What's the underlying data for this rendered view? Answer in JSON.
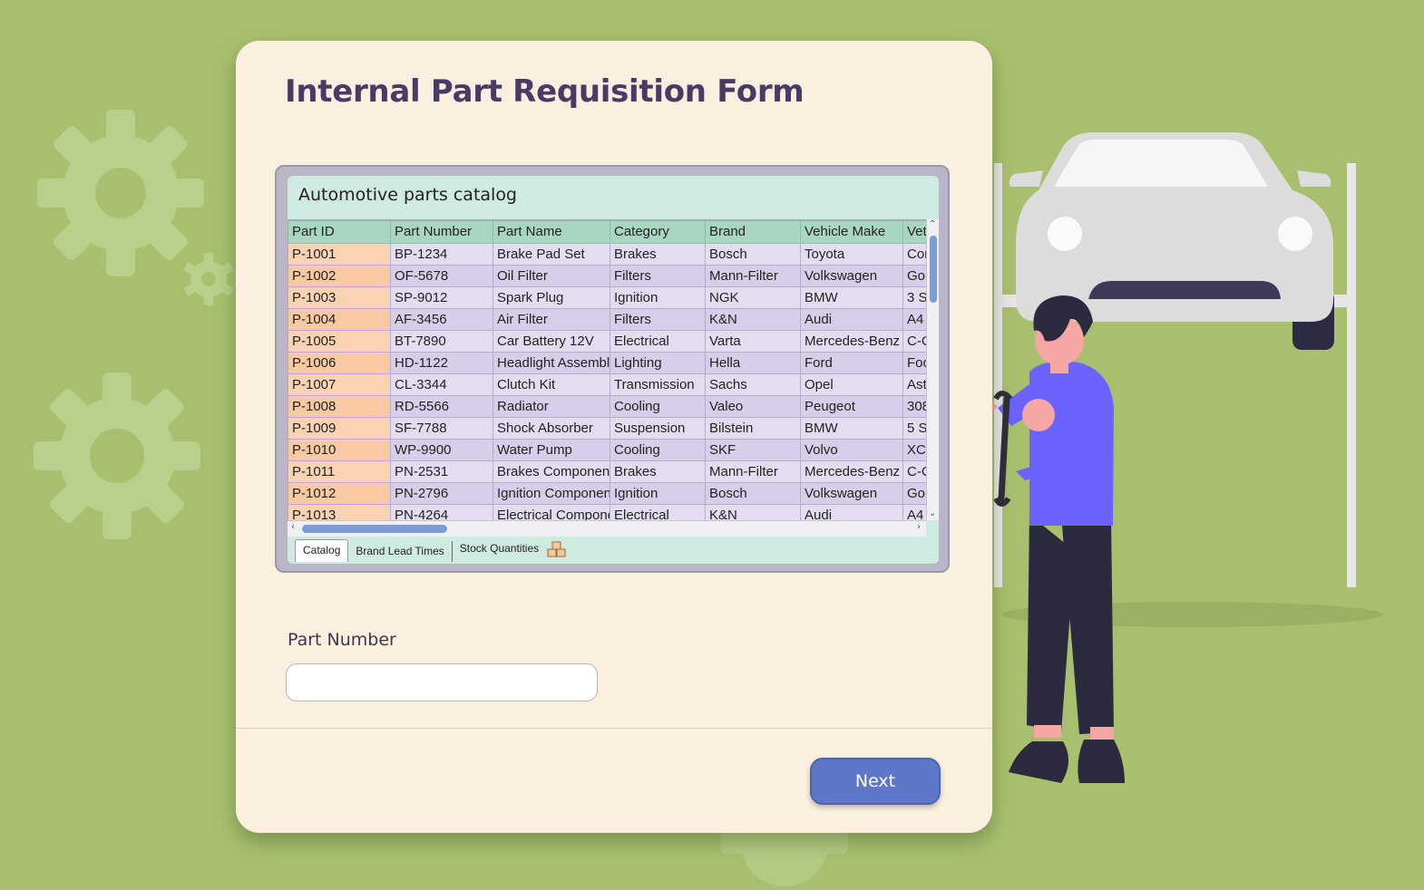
{
  "form": {
    "title": "Internal Part Requisition Form",
    "catalog": {
      "title": "Automotive parts catalog",
      "columns": [
        "Part ID",
        "Part Number",
        "Part Name",
        "Category",
        "Brand",
        "Vehicle Make",
        "Vet"
      ],
      "rows": [
        [
          "P-1001",
          "BP-1234",
          "Brake Pad Set",
          "Brakes",
          "Bosch",
          "Toyota",
          "Cor"
        ],
        [
          "P-1002",
          "OF-5678",
          "Oil Filter",
          "Filters",
          "Mann-Filter",
          "Volkswagen",
          "Gol"
        ],
        [
          "P-1003",
          "SP-9012",
          "Spark Plug",
          "Ignition",
          "NGK",
          "BMW",
          "3 S"
        ],
        [
          "P-1004",
          "AF-3456",
          "Air Filter",
          "Filters",
          "K&N",
          "Audi",
          "A4"
        ],
        [
          "P-1005",
          "BT-7890",
          "Car Battery 12V",
          "Electrical",
          "Varta",
          "Mercedes-Benz",
          "C-C"
        ],
        [
          "P-1006",
          "HD-1122",
          "Headlight Assembl",
          "Lighting",
          "Hella",
          "Ford",
          "Foc"
        ],
        [
          "P-1007",
          "CL-3344",
          "Clutch Kit",
          "Transmission",
          "Sachs",
          "Opel",
          "Ast"
        ],
        [
          "P-1008",
          "RD-5566",
          "Radiator",
          "Cooling",
          "Valeo",
          "Peugeot",
          "308"
        ],
        [
          "P-1009",
          "SF-7788",
          "Shock Absorber",
          "Suspension",
          "Bilstein",
          "BMW",
          "5 S"
        ],
        [
          "P-1010",
          "WP-9900",
          "Water Pump",
          "Cooling",
          "SKF",
          "Volvo",
          "XC9"
        ],
        [
          "P-1011",
          "PN-2531",
          "Brakes Component",
          "Brakes",
          "Mann-Filter",
          "Mercedes-Benz",
          "C-C"
        ],
        [
          "P-1012",
          "PN-2796",
          "Ignition Componen",
          "Ignition",
          "Bosch",
          "Volkswagen",
          "Gol"
        ],
        [
          "P-1013",
          "PN-4264",
          "Electrical Compone",
          "Electrical",
          "K&N",
          "Audi",
          "A4"
        ]
      ],
      "tabs": [
        {
          "label": "Catalog",
          "active": true
        },
        {
          "label": "Brand Lead Times",
          "active": false
        },
        {
          "label": "Stock Quantities",
          "active": false,
          "icon": "boxes-icon"
        }
      ]
    },
    "part_number": {
      "label": "Part Number",
      "value": "",
      "placeholder": ""
    },
    "next_label": "Next"
  },
  "colors": {
    "background": "#a8c06e",
    "card": "#fbf0df",
    "title": "#4a3b66",
    "header_row": "#a9d6c2",
    "id_column": "#fcd3b0",
    "button": "#5e78c9"
  }
}
